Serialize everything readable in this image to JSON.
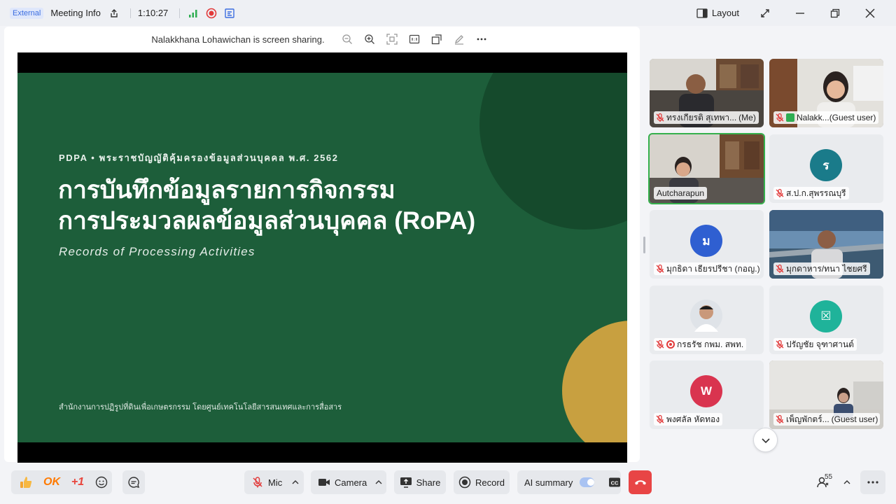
{
  "topbar": {
    "external_badge": "External",
    "meeting_info": "Meeting Info",
    "timer": "1:10:27",
    "layout_label": "Layout"
  },
  "share": {
    "sharing_text": "Nalakkhana Lohawichan is screen sharing."
  },
  "slide": {
    "kicker": "PDPA  •  พระราชบัญญัติคุ้มครองข้อมูลส่วนบุคคล พ.ศ. 2562",
    "title_line1": "การบันทึกข้อมูลรายการกิจกรรม",
    "title_line2": "การประมวลผลข้อมูลส่วนบุคคล (RoPA)",
    "subtitle": "Records of Processing Activities",
    "footer": "สำนักงานการปฏิรูปที่ดินเพื่อเกษตรกรรม โดยศูนย์เทคโนโลยีสารสนเทศและการสื่อสาร",
    "bg_color": "#1d5e3a",
    "accent_gold": "#c8a040"
  },
  "participants": [
    {
      "name": "ทรงเกียรติ สุเทพา...",
      "suffix": "(Me)"
    },
    {
      "name": "Nalakk...",
      "suffix": "(Guest user)"
    },
    {
      "name": "Autcharapun",
      "suffix": ""
    },
    {
      "name": "ส.ป.ก.สุพรรณบุรี",
      "suffix": "",
      "avatar": "ร",
      "avatar_color": "#1a7b8a"
    },
    {
      "name": "มุกธิดา เธียรปรีชา (กอญ.)",
      "suffix": "",
      "avatar": "ม",
      "avatar_color": "#2f5fd1"
    },
    {
      "name": "มุกดาหาร/ทนา ไชยศรี",
      "suffix": ""
    },
    {
      "name": "กรธรัช กพม. สพท.",
      "suffix": ""
    },
    {
      "name": "ปรัญชัย จุฑาศานต์",
      "suffix": "",
      "avatar": "☒",
      "avatar_color": "#1fb39a"
    },
    {
      "name": "พงศลัล หัดทอง",
      "suffix": "",
      "avatar": "W",
      "avatar_color": "#d9344f"
    },
    {
      "name": "เพ็ญพักตร์...",
      "suffix": "(Guest user)"
    }
  ],
  "bottombar": {
    "ok_label": "OK",
    "plus_one_label": "+1",
    "mic_label": "Mic",
    "camera_label": "Camera",
    "share_label": "Share",
    "record_label": "Record",
    "ai_summary_label": "AI summary",
    "participants_count": "55"
  }
}
